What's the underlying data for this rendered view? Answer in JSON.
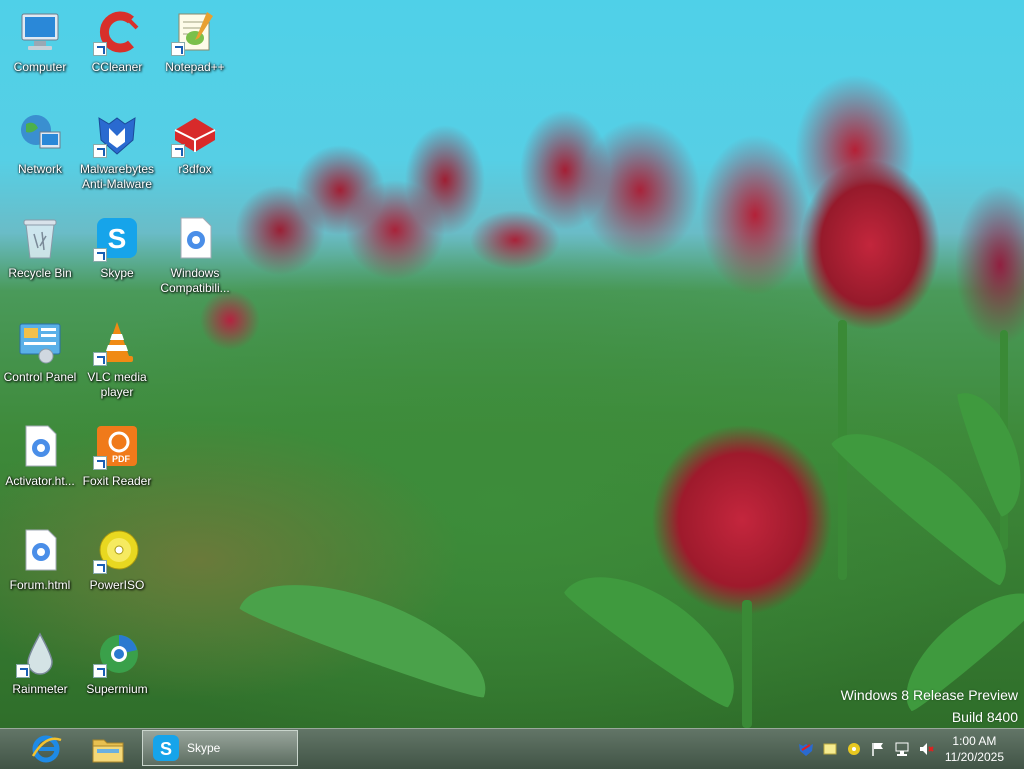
{
  "desktop": {
    "icons": [
      {
        "label": "Computer"
      },
      {
        "label": "CCleaner"
      },
      {
        "label": "Notepad++"
      },
      {
        "label": "Network"
      },
      {
        "label": "Malwarebytes Anti-Malware"
      },
      {
        "label": "r3dfox"
      },
      {
        "label": "Recycle Bin"
      },
      {
        "label": "Skype"
      },
      {
        "label": "Windows Compatibili..."
      },
      {
        "label": "Control Panel"
      },
      {
        "label": "VLC media player"
      },
      {
        "label": "Activator.ht..."
      },
      {
        "label": "Foxit Reader"
      },
      {
        "label": "Forum.html"
      },
      {
        "label": "PowerISO"
      },
      {
        "label": "Rainmeter"
      },
      {
        "label": "Supermium"
      }
    ],
    "watermark": {
      "line1": "Windows 8 Release Preview",
      "line2": "Build 8400"
    }
  },
  "taskbar": {
    "pinned": [
      {
        "icon": "internet-explorer-icon"
      },
      {
        "icon": "file-explorer-icon"
      }
    ],
    "running": {
      "label": "Skype"
    },
    "clock": {
      "time": "1:00 AM",
      "date": "11/20/2025"
    }
  },
  "colors": {
    "sky": "#4fd0e8",
    "tulip": "#c4263d",
    "leaf": "#3f9a3e",
    "taskbar": "#4a5e4e"
  }
}
